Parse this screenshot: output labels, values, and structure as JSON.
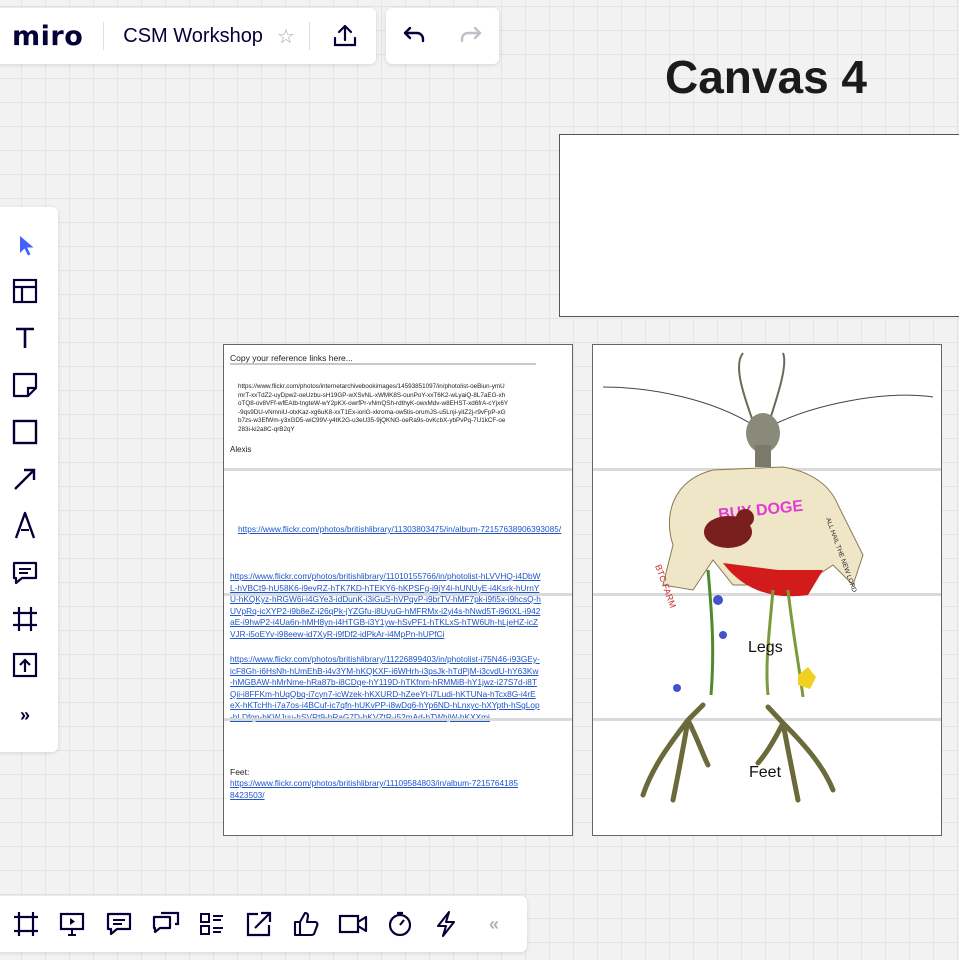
{
  "app": {
    "logo": "miro",
    "board_title": "CSM Workshop"
  },
  "icons": {
    "star": "star-icon",
    "upload": "upload-icon",
    "undo": "undo-icon",
    "redo": "redo-icon",
    "left_tools": [
      "select-cursor-icon",
      "templates-icon",
      "text-icon",
      "sticky-note-icon",
      "shape-icon",
      "arrow-connector-icon",
      "pen-icon",
      "comment-icon",
      "frame-icon",
      "upload-tool-icon",
      "more-tools-icon"
    ],
    "bottom_tools": [
      "frames-icon",
      "presentation-icon",
      "comments-icon",
      "chat-icon",
      "cards-icon",
      "share-screen-icon",
      "voting-icon",
      "video-call-icon",
      "timer-icon",
      "activity-icon",
      "collapse-icon"
    ]
  },
  "canvas": {
    "title": "Canvas 4"
  },
  "left_frame": {
    "heading": "Copy your reference links here...",
    "ref_url_1": "https://www.flickr.com/photos/internetarchivebookimages/14593851097/in/photolist-oeBiun-ymUmrT-xxTdZ2-uyDpw2-oeUzbu-sH19GP-wXSvNL-xWMK8S-ounPoY-xxT6K2-wLyaiQ-8L7aEG-xhoTQ8-ov8VFf-wfEAtb-tngteW-wY2pKX-owrfPr-vNmQSh-rdthyK-owxMdv-w8EHST-xd6frA-cYjx6Y-9qs9DU-vNmniU-otxKaz-xg6uK8-xxT1Ex-ioriG-xkroma-ow5tis-orumJS-u5Lnji-yitZ2j-r9vFpP-xGb7zs-w3EfWm-y3xGD5-wiC99V-y4tK2G-u3eU35-9jQKNG-oeRa9s-ovKcbX-ybPvPq-7U1kCF-oe283i-ki2a8C-qrB2qY",
    "author": "Alexis",
    "ref_url_2": "https://www.flickr.com/photos/britishlibrary/11303803475/in/album-72157638906393085/",
    "ref_url_3": "https://www.flickr.com/photos/britishlibrary/11010155766/in/photolist-hLVVHQ-i4DbWL-hVBCt9-hU58K6-i9evRZ-hTK7KD-hTEKY6-hKPSFg-i9jY4i-hUNUyE-i4Ksrk-hUrnYU-hKQKyz-hRGW6i-i4GYe3-idDunK-i3iGuS-hVPqvP-i9brTV-hMF7pk-i9fi5x-i9hcsQ-hUVpRq-icXYP2-i9b8eZ-i26qPk-jYZGfu-i8UyuG-hMFRMx-i2yi4s-hNwd5T-i96tXL-i942aE-i9hwP2-i4Ua6n-hMH8yn-i4HTGB-i3Y1yw-hSvPF1-hTKLxS-hTW6Uh-hLjeHZ-icZVJR-i5oEYv-i98eew-id7XyR-i9fDf2-idPkAr-i4MpPn-hUPfCi",
    "ref_url_4": "https://www.flickr.com/photos/britishlibrary/11226899403/in/photolist-i75N46-i93GEy-icF8Gh-i6HsNh-hUmEhB-i4v3YM-hKQKXF-i6WHrh-i3psJk-hTdPjM-i3cvdU-hY63Kw-hMGBAW-hMrNme-hRa87b-i8CDqe-hY119D-hTKfnm-hRMMiB-hY1jwz-i27S7d-i8TQii-i8FFKm-hUqQbq-i7cyn7-icWzek-hKXURD-hZeeYt-i7Ludi-hKTUNa-hTcx8G-i4rEeX-hKTcHh-i7a7os-i4BCuf-ic7qfn-hUKvPP-i8wDq6-hYp6ND-hLnxyc-hXYpth-hSgLop-hLDfqn-hKWJuu-hSVRt9-hRaG7D-hKVZtR-i52mAd-hTWhjW-hKXXmi",
    "feet_label": "Feet:",
    "feet_url": "https://www.flickr.com/photos/britishlibrary/11109584803/in/album-72157641858423503/"
  },
  "right_frame": {
    "sticker_text": "BUY DOGE",
    "left_scribble": "BTC FARM",
    "right_scribble": "ALL HAIL THE NEW LORD",
    "legs_label": "Legs",
    "feet_label": "Feet"
  },
  "colors": {
    "accent": "#4262ff",
    "doge_pink": "#e23ad6",
    "link": "#1f55c9"
  }
}
